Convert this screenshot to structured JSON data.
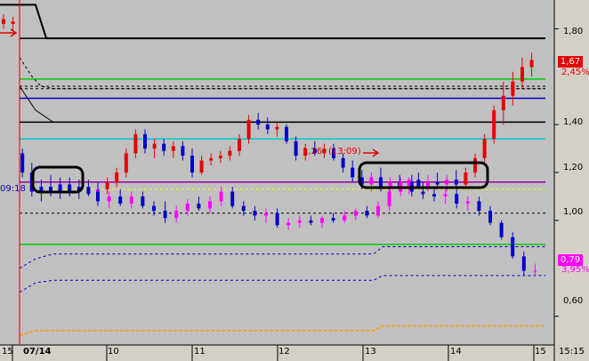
{
  "chart_data": {
    "type": "candlestick",
    "y_ticks": [
      {
        "label": "1,80",
        "value": 1.8
      },
      {
        "label": "1,40",
        "value": 1.4
      },
      {
        "label": "1,20",
        "value": 1.2
      },
      {
        "label": "1,00",
        "value": 1.0
      },
      {
        "label": "0,60",
        "value": 0.6
      }
    ],
    "ylim": [
      0.48,
      1.92
    ],
    "x_ticks": [
      "15",
      "07/14",
      "10",
      "11",
      "12",
      "13",
      "14",
      "15",
      "15:15"
    ],
    "last_price": {
      "label": "1,67",
      "pct": "2,45%",
      "value": 1.67,
      "color": "#e60000"
    },
    "low_price": {
      "label": "0,79",
      "pct": "3,95%",
      "value": 0.79,
      "color": "#ff00ff"
    },
    "time_left": "09:18",
    "annotation": "(13:09)",
    "annotation_prefix": "1,26",
    "levels": [
      {
        "value": 1.76,
        "color": "#000000"
      },
      {
        "value": 1.59,
        "color": "#00cc00"
      },
      {
        "value": 1.51,
        "color": "#0000cc"
      },
      {
        "value": 1.41,
        "color": "#000000"
      },
      {
        "value": 1.34,
        "color": "#00cccc"
      },
      {
        "value": 1.16,
        "color": "#990099"
      },
      {
        "value": 0.9,
        "color": "#00cc00"
      }
    ],
    "dashed_levels": [
      {
        "value": 1.56,
        "color": "#000000"
      },
      {
        "value": 1.55,
        "color": "#000000"
      },
      {
        "value": 1.03,
        "color": "#000000"
      }
    ],
    "candles": [
      {
        "o": 1.84,
        "h": 1.86,
        "l": 1.8,
        "c": 1.82,
        "d": 1
      },
      {
        "o": 1.82,
        "h": 1.85,
        "l": 1.79,
        "c": 1.83,
        "d": 1
      },
      {
        "o": 1.28,
        "h": 1.3,
        "l": 1.18,
        "c": 1.2,
        "d": 0
      },
      {
        "o": 1.2,
        "h": 1.24,
        "l": 1.1,
        "c": 1.12,
        "d": 0
      },
      {
        "o": 1.12,
        "h": 1.17,
        "l": 1.08,
        "c": 1.14,
        "d": 0
      },
      {
        "o": 1.14,
        "h": 1.19,
        "l": 1.1,
        "c": 1.12,
        "d": 0
      },
      {
        "o": 1.12,
        "h": 1.18,
        "l": 1.09,
        "c": 1.15,
        "d": 0
      },
      {
        "o": 1.15,
        "h": 1.18,
        "l": 1.1,
        "c": 1.12,
        "d": 0
      },
      {
        "o": 1.12,
        "h": 1.17,
        "l": 1.09,
        "c": 1.14,
        "d": 0
      },
      {
        "o": 1.14,
        "h": 1.17,
        "l": 1.1,
        "c": 1.11,
        "d": 0
      },
      {
        "o": 1.11,
        "h": 1.16,
        "l": 1.09,
        "c": 1.13,
        "d": 2
      },
      {
        "o": 1.13,
        "h": 1.18,
        "l": 1.11,
        "c": 1.16,
        "d": 1
      },
      {
        "o": 1.16,
        "h": 1.22,
        "l": 1.14,
        "c": 1.2,
        "d": 1
      },
      {
        "o": 1.2,
        "h": 1.3,
        "l": 1.18,
        "c": 1.28,
        "d": 1
      },
      {
        "o": 1.28,
        "h": 1.38,
        "l": 1.26,
        "c": 1.36,
        "d": 1
      },
      {
        "o": 1.36,
        "h": 1.38,
        "l": 1.28,
        "c": 1.3,
        "d": 0
      },
      {
        "o": 1.3,
        "h": 1.34,
        "l": 1.26,
        "c": 1.32,
        "d": 1
      },
      {
        "o": 1.32,
        "h": 1.34,
        "l": 1.27,
        "c": 1.29,
        "d": 0
      },
      {
        "o": 1.29,
        "h": 1.33,
        "l": 1.26,
        "c": 1.31,
        "d": 1
      },
      {
        "o": 1.31,
        "h": 1.33,
        "l": 1.25,
        "c": 1.27,
        "d": 0
      },
      {
        "o": 1.27,
        "h": 1.3,
        "l": 1.18,
        "c": 1.2,
        "d": 0
      },
      {
        "o": 1.2,
        "h": 1.27,
        "l": 1.19,
        "c": 1.25,
        "d": 1
      },
      {
        "o": 1.25,
        "h": 1.28,
        "l": 1.23,
        "c": 1.26,
        "d": 1
      },
      {
        "o": 1.26,
        "h": 1.29,
        "l": 1.24,
        "c": 1.27,
        "d": 1
      },
      {
        "o": 1.27,
        "h": 1.31,
        "l": 1.25,
        "c": 1.29,
        "d": 1
      },
      {
        "o": 1.29,
        "h": 1.36,
        "l": 1.27,
        "c": 1.34,
        "d": 1
      },
      {
        "o": 1.34,
        "h": 1.44,
        "l": 1.32,
        "c": 1.42,
        "d": 1
      },
      {
        "o": 1.42,
        "h": 1.45,
        "l": 1.38,
        "c": 1.4,
        "d": 0
      },
      {
        "o": 1.4,
        "h": 1.43,
        "l": 1.36,
        "c": 1.38,
        "d": 0
      },
      {
        "o": 1.38,
        "h": 1.41,
        "l": 1.35,
        "c": 1.39,
        "d": 1
      },
      {
        "o": 1.39,
        "h": 1.4,
        "l": 1.32,
        "c": 1.33,
        "d": 0
      },
      {
        "o": 1.33,
        "h": 1.35,
        "l": 1.25,
        "c": 1.27,
        "d": 0
      },
      {
        "o": 1.27,
        "h": 1.32,
        "l": 1.25,
        "c": 1.3,
        "d": 1
      },
      {
        "o": 1.3,
        "h": 1.33,
        "l": 1.27,
        "c": 1.28,
        "d": 0
      },
      {
        "o": 1.28,
        "h": 1.32,
        "l": 1.26,
        "c": 1.3,
        "d": 1
      },
      {
        "o": 1.3,
        "h": 1.32,
        "l": 1.25,
        "c": 1.26,
        "d": 0
      },
      {
        "o": 1.26,
        "h": 1.28,
        "l": 1.2,
        "c": 1.22,
        "d": 0
      },
      {
        "o": 1.22,
        "h": 1.25,
        "l": 1.16,
        "c": 1.18,
        "d": 0
      },
      {
        "o": 1.18,
        "h": 1.21,
        "l": 1.13,
        "c": 1.15,
        "d": 0
      },
      {
        "o": 1.15,
        "h": 1.2,
        "l": 1.12,
        "c": 1.18,
        "d": 2
      },
      {
        "o": 1.18,
        "h": 1.22,
        "l": 1.12,
        "c": 1.14,
        "d": 0
      },
      {
        "o": 1.14,
        "h": 1.18,
        "l": 1.11,
        "c": 1.16,
        "d": 2
      },
      {
        "o": 1.16,
        "h": 1.19,
        "l": 1.12,
        "c": 1.13,
        "d": 0
      },
      {
        "o": 1.13,
        "h": 1.18,
        "l": 1.11,
        "c": 1.17,
        "d": 2
      },
      {
        "o": 1.17,
        "h": 1.2,
        "l": 1.13,
        "c": 1.14,
        "d": 0
      },
      {
        "o": 1.14,
        "h": 1.19,
        "l": 1.12,
        "c": 1.16,
        "d": 2
      },
      {
        "o": 1.16,
        "h": 1.2,
        "l": 1.13,
        "c": 1.15,
        "d": 0
      },
      {
        "o": 1.15,
        "h": 1.19,
        "l": 1.12,
        "c": 1.17,
        "d": 2
      },
      {
        "o": 1.17,
        "h": 1.21,
        "l": 1.14,
        "c": 1.15,
        "d": 0
      },
      {
        "o": 1.15,
        "h": 1.22,
        "l": 1.13,
        "c": 1.2,
        "d": 1
      },
      {
        "o": 1.2,
        "h": 1.28,
        "l": 1.18,
        "c": 1.26,
        "d": 1
      },
      {
        "o": 1.26,
        "h": 1.36,
        "l": 1.24,
        "c": 1.34,
        "d": 1
      },
      {
        "o": 1.34,
        "h": 1.48,
        "l": 1.32,
        "c": 1.46,
        "d": 1
      },
      {
        "o": 1.46,
        "h": 1.58,
        "l": 1.4,
        "c": 1.52,
        "d": 1
      },
      {
        "o": 1.52,
        "h": 1.62,
        "l": 1.48,
        "c": 1.58,
        "d": 1
      },
      {
        "o": 1.58,
        "h": 1.68,
        "l": 1.55,
        "c": 1.64,
        "d": 1
      },
      {
        "o": 1.64,
        "h": 1.7,
        "l": 1.6,
        "c": 1.67,
        "d": 1
      }
    ],
    "candles_low": [
      {
        "o": 1.12,
        "h": 1.16,
        "l": 1.06,
        "c": 1.08,
        "d": 0
      },
      {
        "o": 1.08,
        "h": 1.12,
        "l": 1.05,
        "c": 1.1,
        "d": 2
      },
      {
        "o": 1.1,
        "h": 1.13,
        "l": 1.06,
        "c": 1.07,
        "d": 0
      },
      {
        "o": 1.07,
        "h": 1.12,
        "l": 1.05,
        "c": 1.1,
        "d": 2
      },
      {
        "o": 1.1,
        "h": 1.12,
        "l": 1.05,
        "c": 1.06,
        "d": 0
      },
      {
        "o": 1.06,
        "h": 1.08,
        "l": 1.02,
        "c": 1.04,
        "d": 0
      },
      {
        "o": 1.04,
        "h": 1.08,
        "l": 0.99,
        "c": 1.01,
        "d": 0
      },
      {
        "o": 1.01,
        "h": 1.06,
        "l": 0.99,
        "c": 1.04,
        "d": 2
      },
      {
        "o": 1.04,
        "h": 1.09,
        "l": 1.02,
        "c": 1.07,
        "d": 2
      },
      {
        "o": 1.07,
        "h": 1.1,
        "l": 1.04,
        "c": 1.05,
        "d": 0
      },
      {
        "o": 1.05,
        "h": 1.1,
        "l": 1.03,
        "c": 1.08,
        "d": 2
      },
      {
        "o": 1.08,
        "h": 1.14,
        "l": 1.06,
        "c": 1.12,
        "d": 2
      },
      {
        "o": 1.12,
        "h": 1.14,
        "l": 1.05,
        "c": 1.06,
        "d": 0
      },
      {
        "o": 1.06,
        "h": 1.08,
        "l": 1.02,
        "c": 1.04,
        "d": 0
      },
      {
        "o": 1.04,
        "h": 1.06,
        "l": 1.0,
        "c": 1.02,
        "d": 0
      },
      {
        "o": 1.02,
        "h": 1.05,
        "l": 0.99,
        "c": 1.03,
        "d": 2
      },
      {
        "o": 1.03,
        "h": 1.05,
        "l": 0.97,
        "c": 0.98,
        "d": 0
      },
      {
        "o": 0.98,
        "h": 1.01,
        "l": 0.96,
        "c": 0.99,
        "d": 2
      },
      {
        "o": 0.99,
        "h": 1.02,
        "l": 0.97,
        "c": 1.0,
        "d": 2
      },
      {
        "o": 1.0,
        "h": 1.02,
        "l": 0.98,
        "c": 0.99,
        "d": 0
      },
      {
        "o": 0.99,
        "h": 1.02,
        "l": 0.97,
        "c": 1.01,
        "d": 2
      },
      {
        "o": 1.01,
        "h": 1.03,
        "l": 0.99,
        "c": 1.0,
        "d": 0
      },
      {
        "o": 1.0,
        "h": 1.04,
        "l": 0.99,
        "c": 1.02,
        "d": 2
      },
      {
        "o": 1.02,
        "h": 1.05,
        "l": 1.0,
        "c": 1.04,
        "d": 2
      },
      {
        "o": 1.04,
        "h": 1.06,
        "l": 1.01,
        "c": 1.02,
        "d": 0
      },
      {
        "o": 1.02,
        "h": 1.08,
        "l": 1.01,
        "c": 1.06,
        "d": 2
      },
      {
        "o": 1.06,
        "h": 1.14,
        "l": 1.04,
        "c": 1.12,
        "d": 2
      },
      {
        "o": 1.12,
        "h": 1.18,
        "l": 1.1,
        "c": 1.16,
        "d": 2
      },
      {
        "o": 1.16,
        "h": 1.19,
        "l": 1.1,
        "c": 1.12,
        "d": 0
      },
      {
        "o": 1.12,
        "h": 1.16,
        "l": 1.09,
        "c": 1.11,
        "d": 0
      },
      {
        "o": 1.11,
        "h": 1.14,
        "l": 1.08,
        "c": 1.1,
        "d": 0
      },
      {
        "o": 1.1,
        "h": 1.13,
        "l": 1.07,
        "c": 1.11,
        "d": 2
      },
      {
        "o": 1.11,
        "h": 1.13,
        "l": 1.05,
        "c": 1.07,
        "d": 0
      },
      {
        "o": 1.07,
        "h": 1.1,
        "l": 1.04,
        "c": 1.08,
        "d": 2
      },
      {
        "o": 1.08,
        "h": 1.1,
        "l": 1.02,
        "c": 1.04,
        "d": 0
      },
      {
        "o": 1.04,
        "h": 1.06,
        "l": 0.98,
        "c": 0.99,
        "d": 0
      },
      {
        "o": 0.99,
        "h": 1.0,
        "l": 0.92,
        "c": 0.93,
        "d": 0
      },
      {
        "o": 0.93,
        "h": 0.95,
        "l": 0.84,
        "c": 0.85,
        "d": 0
      },
      {
        "o": 0.85,
        "h": 0.87,
        "l": 0.77,
        "c": 0.79,
        "d": 0
      },
      {
        "o": 0.79,
        "h": 0.82,
        "l": 0.77,
        "c": 0.79,
        "d": 2
      }
    ]
  }
}
